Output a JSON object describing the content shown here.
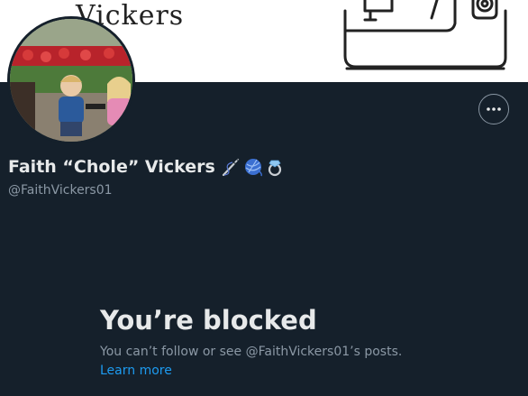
{
  "banner": {
    "text": "Vickers"
  },
  "profile": {
    "display_name": "Faith “Chole” Vickers",
    "handle": "@FaithVickers01",
    "emojis": [
      "sewing-needle-icon",
      "yarn-ball-icon",
      "ring-icon"
    ]
  },
  "more_button": {
    "icon": "more-horizontal-icon"
  },
  "blocked": {
    "title": "You’re blocked",
    "description": "You can’t follow or see @FaithVickers01’s posts.",
    "learn_more": "Learn more"
  },
  "colors": {
    "background": "#15202b",
    "text_primary": "#e7e9ea",
    "text_secondary": "#8b98a5",
    "link": "#1d9bf0"
  }
}
